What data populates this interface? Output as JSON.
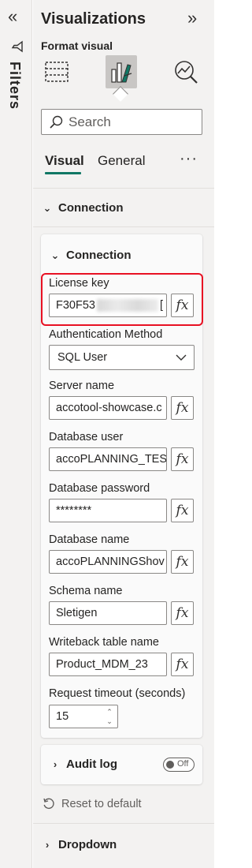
{
  "filters_rail": {
    "collapse_icon": "«",
    "label": "Filters"
  },
  "pane": {
    "title": "Visualizations",
    "expand_icon": "»",
    "format_visual_label": "Format visual",
    "search_placeholder": "Search",
    "tabs": [
      {
        "label": "Visual"
      },
      {
        "label": "General"
      }
    ],
    "more_icon": "···"
  },
  "sections": {
    "connection_outer": {
      "label": "Connection"
    },
    "connection_inner": {
      "label": "Connection"
    },
    "audit": {
      "label": "Audit log",
      "toggle_label": "Off"
    },
    "reset": {
      "label": "Reset to default"
    },
    "dropdown_section": {
      "label": "Dropdown"
    }
  },
  "fields": {
    "license_key": {
      "label": "License key",
      "value_prefix": "F30F53",
      "value_suffix": "[",
      "fx": "fx"
    },
    "auth_method": {
      "label": "Authentication Method",
      "value": "SQL User"
    },
    "server_name": {
      "label": "Server name",
      "value": "accotool-showcase.c",
      "fx": "fx"
    },
    "db_user": {
      "label": "Database user",
      "value": "accoPLANNING_TES",
      "fx": "fx"
    },
    "db_password": {
      "label": "Database password",
      "value": "********",
      "fx": "fx"
    },
    "db_name": {
      "label": "Database name",
      "value": "accoPLANNINGShov",
      "fx": "fx"
    },
    "schema_name": {
      "label": "Schema name",
      "value": "Sletigen",
      "fx": "fx"
    },
    "writeback_table": {
      "label": "Writeback table name",
      "value": "Product_MDM_23",
      "fx": "fx"
    },
    "request_timeout": {
      "label": "Request timeout (seconds)",
      "value": "15"
    }
  },
  "colors": {
    "accent": "#117865",
    "highlight": "#e81123",
    "pane_bg": "#f3f2f1"
  }
}
